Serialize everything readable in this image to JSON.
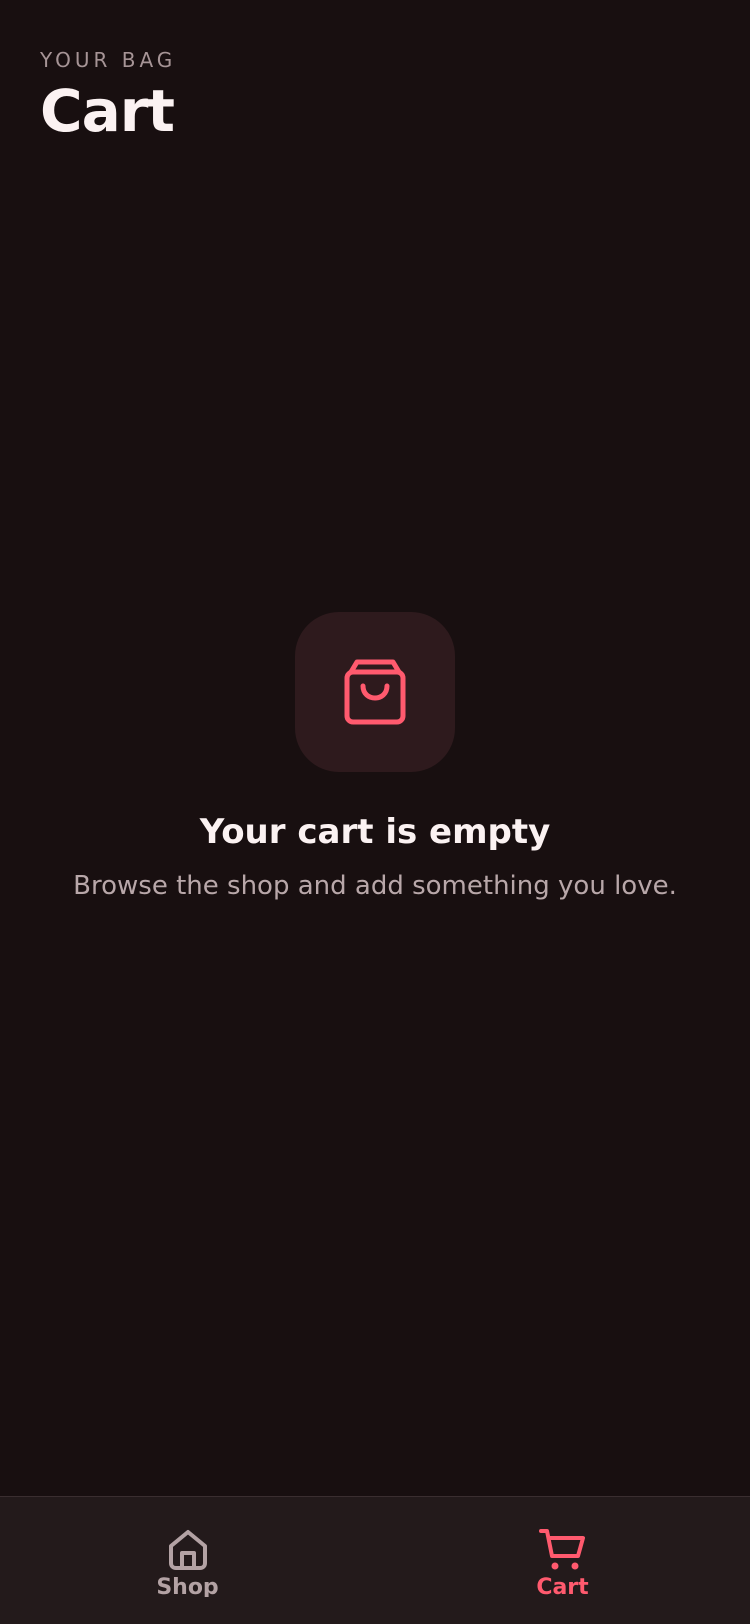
{
  "header": {
    "eyebrow": "YOUR BAG",
    "title": "Cart"
  },
  "empty_state": {
    "icon": "shopping-bag-icon",
    "title": "Your cart is empty",
    "subtitle": "Browse the shop and add something you love."
  },
  "tabbar": {
    "items": [
      {
        "label": "Shop",
        "icon": "home-icon",
        "active": false
      },
      {
        "label": "Cart",
        "icon": "cart-icon",
        "active": true
      }
    ]
  },
  "colors": {
    "background": "#180f10",
    "accent": "#ff5a6e",
    "icon_tile": "#2e1a1d",
    "tabbar": "#231a1b",
    "inactive_tab": "#b3a2a4"
  }
}
